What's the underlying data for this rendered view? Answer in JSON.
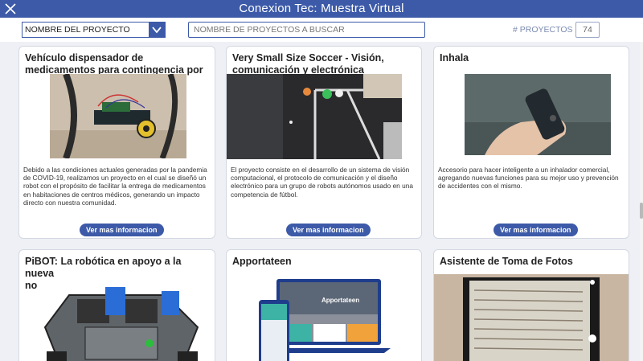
{
  "app": {
    "title": "Conexion Tec: Muestra Virtual"
  },
  "toolbar": {
    "filter_selected": "NOMBRE DEL PROYECTO",
    "search_placeholder": "NOMBRE DE PROYECTOS A BUSCAR",
    "count_label": "# PROYECTOS",
    "count_value": "74"
  },
  "cards": [
    {
      "title": "Vehículo dispensador de\nmedicamentos para contingencia por",
      "description": "Debido a las condiciones actuales generadas por la pandemia de COVID-19, realizamos un proyecto en el cual se diseñó un robot con el propósito de facilitar la entrega de medicamentos en habitaciones de centros médicos, generando un impacto directo con nuestra comunidad.",
      "button": "Ver mas informacion"
    },
    {
      "title": "Very Small Size Soccer - Visión,\ncomunicación y electrónica",
      "description": "El proyecto consiste en el desarrollo de un sistema de visión computacional, el protocolo de comunicación y el diseño electrónico para un grupo de robots autónomos usado en una competencia de fútbol.",
      "button": "Ver mas informacion"
    },
    {
      "title": "Inhala",
      "description": "Accesorio para hacer inteligente a un inhalador comercial, agregando nuevas funciones para su mejor uso y prevención de accidentes con el mismo.",
      "button": "Ver mas informacion"
    },
    {
      "title": "PiBOT: La robótica en apoyo a la nueva\nnormalidad"
    },
    {
      "title": "Apportateen",
      "screen_text": "Apportateen"
    },
    {
      "title": "Asistente de Toma de Fotos"
    }
  ],
  "colors": {
    "brand": "#3c5aa8",
    "background": "#eef0f5"
  }
}
